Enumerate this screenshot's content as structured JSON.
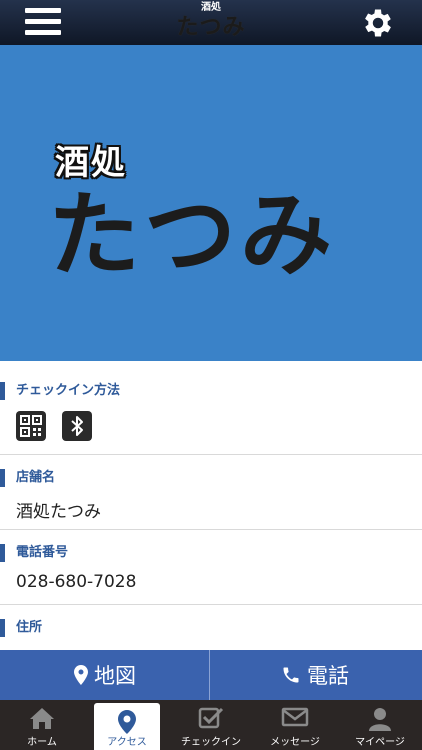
{
  "header": {
    "logo_top": "酒処",
    "logo_bottom": "たつみ"
  },
  "hero": {
    "subtitle": "酒処",
    "title": "たつみ"
  },
  "sections": {
    "checkin": {
      "title": "チェックイン方法"
    },
    "shop": {
      "title": "店舗名",
      "value": "酒処たつみ"
    },
    "phone": {
      "title": "電話番号",
      "value": "028-680-7028"
    },
    "address": {
      "title": "住所",
      "value": ""
    }
  },
  "actions": {
    "map_label": "地図",
    "call_label": "電話"
  },
  "tabs": [
    {
      "label": "ホーム",
      "icon": "home-icon"
    },
    {
      "label": "アクセス",
      "icon": "location-pin-icon"
    },
    {
      "label": "チェックイン",
      "icon": "checkin-icon"
    },
    {
      "label": "メッセージ",
      "icon": "mail-icon"
    },
    {
      "label": "マイページ",
      "icon": "person-icon"
    }
  ],
  "colors": {
    "header_bg": "#1a2438",
    "hero_bg": "#3a82c8",
    "accent": "#2f5a9a",
    "action_bar": "#3a62ae",
    "tabbar_bg": "#2b2625"
  }
}
